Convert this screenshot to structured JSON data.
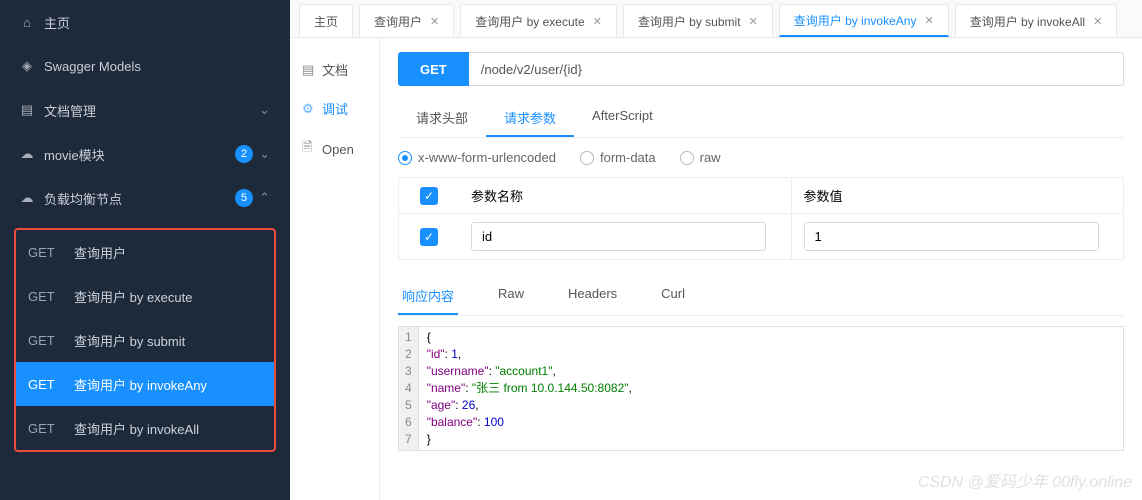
{
  "sidebar": {
    "items": [
      {
        "label": "主页"
      },
      {
        "label": "Swagger Models"
      },
      {
        "label": "文档管理"
      },
      {
        "label": "movie模块",
        "badge": "2"
      },
      {
        "label": "负载均衡节点",
        "badge": "5"
      }
    ],
    "apis": [
      {
        "method": "GET",
        "name": "查询用户"
      },
      {
        "method": "GET",
        "name": "查询用户 by execute"
      },
      {
        "method": "GET",
        "name": "查询用户 by submit"
      },
      {
        "method": "GET",
        "name": "查询用户 by invokeAny",
        "active": true
      },
      {
        "method": "GET",
        "name": "查询用户 by invokeAll"
      }
    ]
  },
  "tabs": [
    {
      "label": "主页",
      "closable": false
    },
    {
      "label": "查询用户",
      "closable": true
    },
    {
      "label": "查询用户 by execute",
      "closable": true
    },
    {
      "label": "查询用户 by submit",
      "closable": true
    },
    {
      "label": "查询用户 by invokeAny",
      "closable": true,
      "active": true
    },
    {
      "label": "查询用户 by invokeAll",
      "closable": true
    }
  ],
  "subnav": [
    {
      "label": "文档"
    },
    {
      "label": "调试",
      "active": true
    },
    {
      "label": "Open"
    }
  ],
  "request": {
    "method": "GET",
    "url": "/node/v2/user/{id}"
  },
  "paramTabs": [
    {
      "label": "请求头部"
    },
    {
      "label": "请求参数",
      "active": true
    },
    {
      "label": "AfterScript"
    }
  ],
  "bodyTypes": [
    {
      "label": "x-www-form-urlencoded",
      "checked": true
    },
    {
      "label": "form-data"
    },
    {
      "label": "raw"
    }
  ],
  "paramTable": {
    "headers": {
      "name": "参数名称",
      "value": "参数值"
    },
    "rows": [
      {
        "name": "id",
        "value": "1"
      }
    ]
  },
  "respTabs": [
    {
      "label": "响应内容",
      "active": true
    },
    {
      "label": "Raw"
    },
    {
      "label": "Headers"
    },
    {
      "label": "Curl"
    }
  ],
  "response": {
    "id": 1,
    "username": "account1",
    "name": "张三 from 10.0.144.50:8082",
    "age": 26,
    "balance": 100
  },
  "watermark": "CSDN @爱码少年 00fly.online",
  "glyphs": {
    "close": "✕",
    "check": "✓",
    "chev_down": "⌄",
    "chev_up": "⌃"
  }
}
